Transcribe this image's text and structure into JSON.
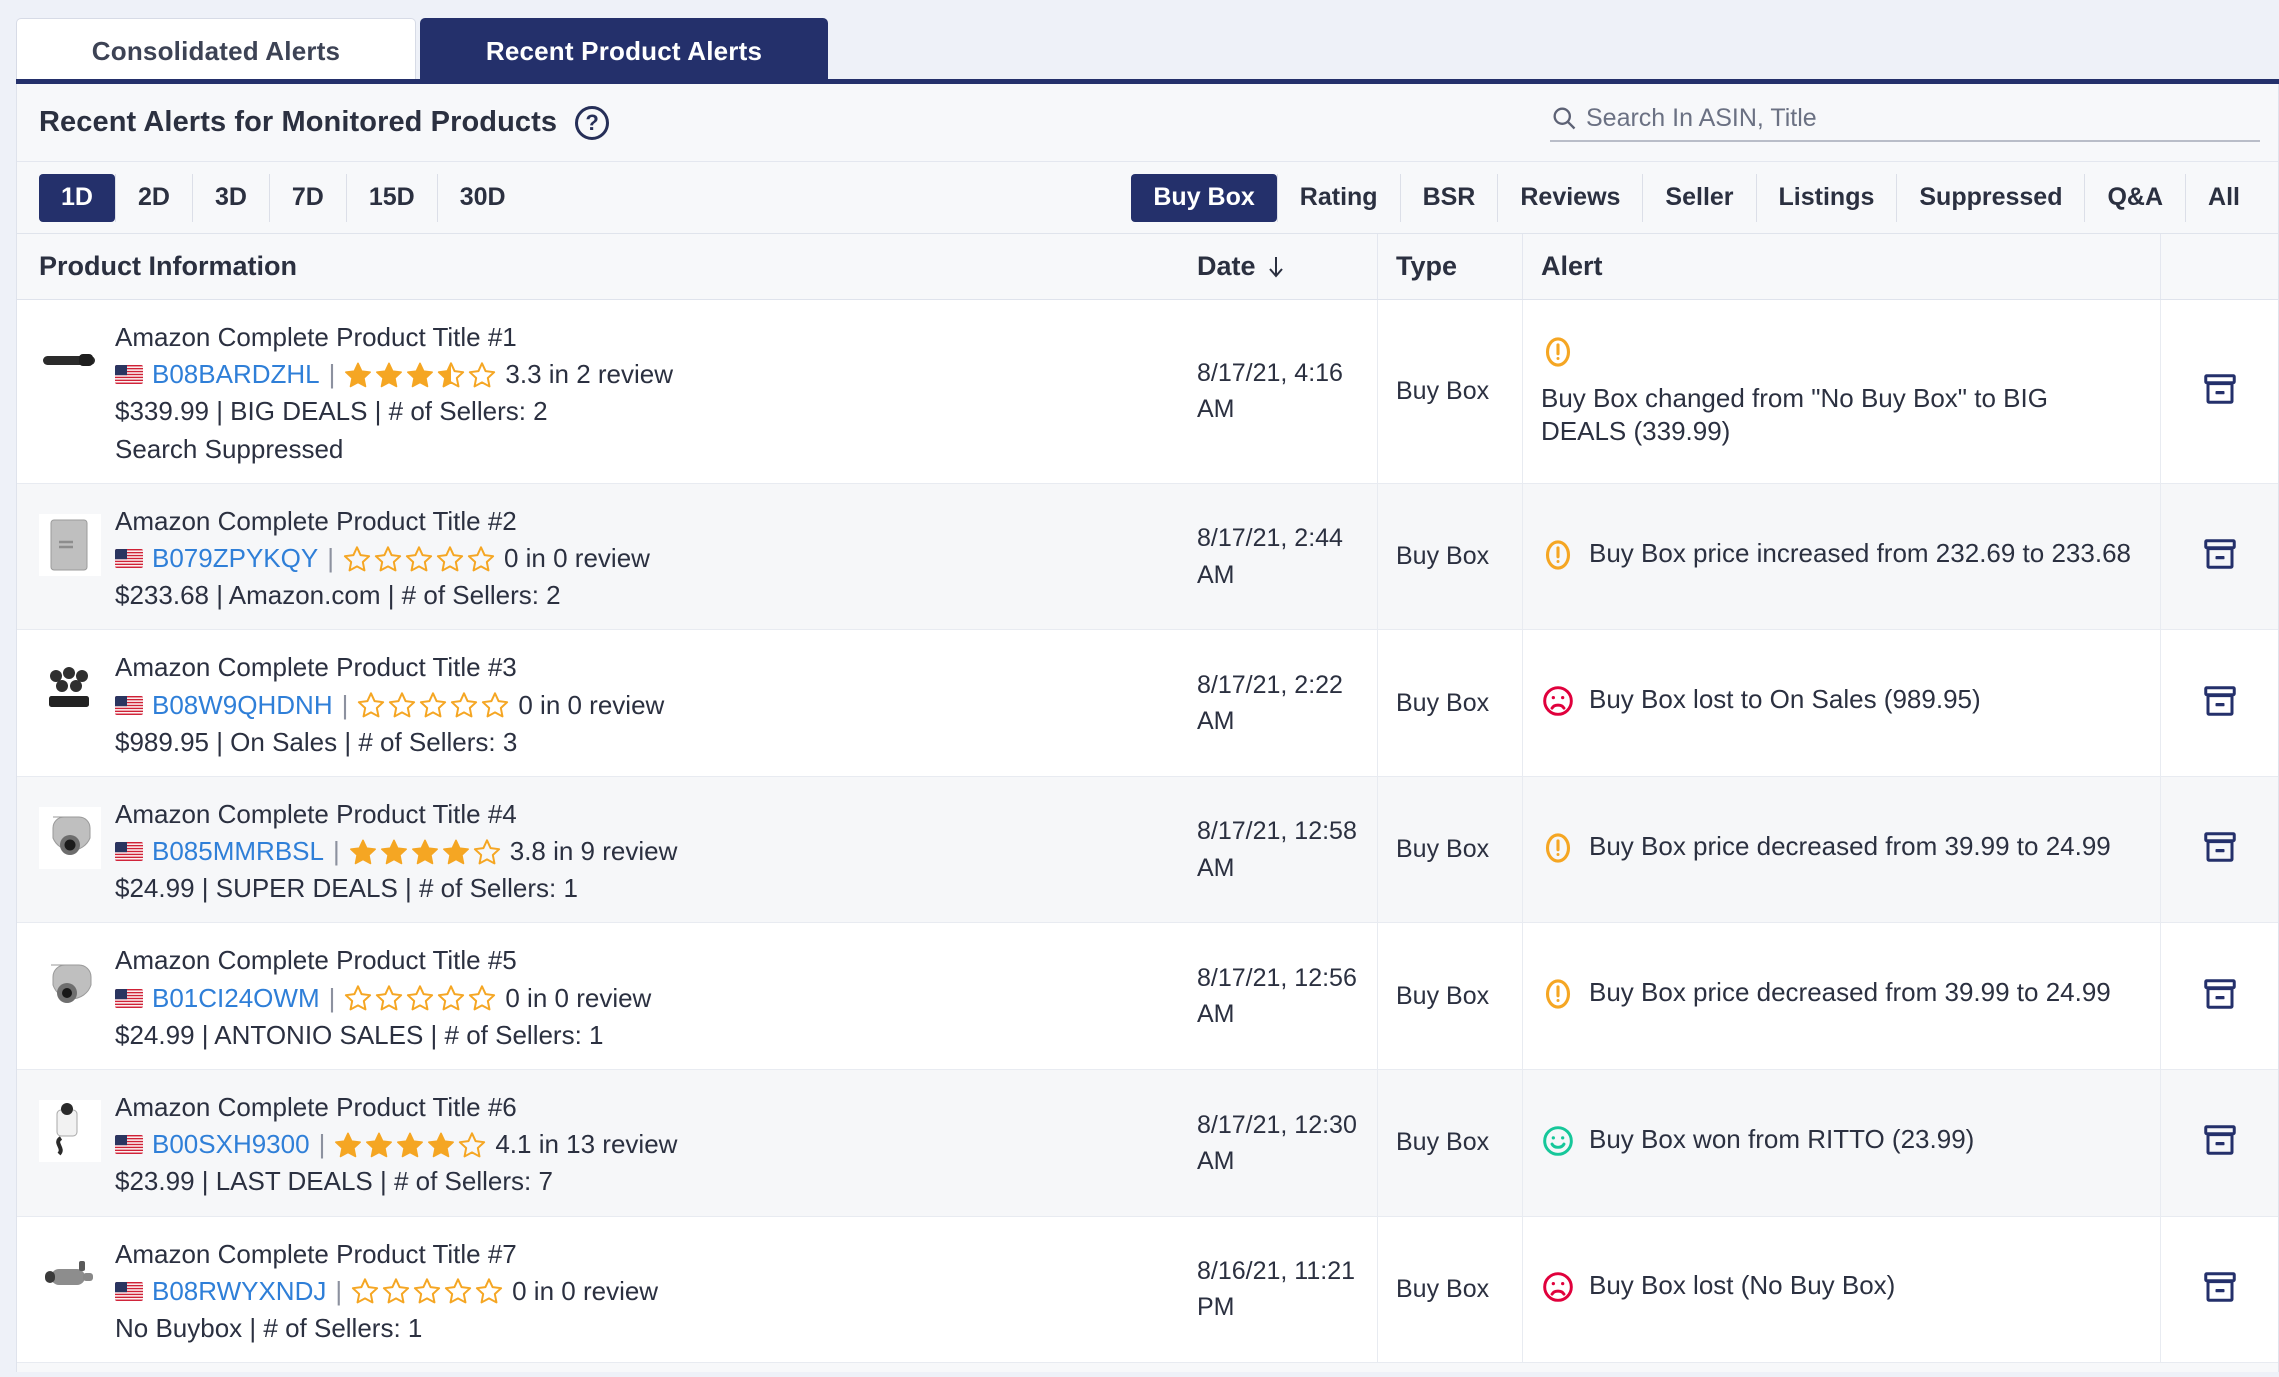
{
  "tabs": [
    {
      "label": "Consolidated Alerts",
      "active": false
    },
    {
      "label": "Recent Product Alerts",
      "active": true
    }
  ],
  "panel": {
    "title": "Recent Alerts for Monitored Products",
    "help_icon": "question-mark-circle-icon"
  },
  "search": {
    "placeholder": "Search In ASIN, Title",
    "value": "",
    "icon": "search-icon"
  },
  "filters": {
    "range": {
      "options": [
        "1D",
        "2D",
        "3D",
        "7D",
        "15D",
        "30D"
      ],
      "selected": "1D"
    },
    "type": {
      "options": [
        "Buy Box",
        "Rating",
        "BSR",
        "Reviews",
        "Seller",
        "Listings",
        "Suppressed",
        "Q&A",
        "All"
      ],
      "selected": "Buy Box"
    }
  },
  "table": {
    "columns": [
      "Product Information",
      "Date",
      "Type",
      "Alert"
    ],
    "sort_column": "Date",
    "sort_icon": "arrow-down-icon",
    "archive_icon": "archive-box-icon",
    "rows": [
      {
        "title": "Amazon Complete Product Title #1",
        "flag": "us-flag-icon",
        "asin": "B08BARDZHL",
        "stars": 3.5,
        "rating_text": "3.3 in 2 review",
        "price": "$339.99",
        "seller": "BIG DEALS",
        "sellers": "# of Sellers: 2",
        "extra": "Search Suppressed",
        "date": "8/17/21, 4:16 AM",
        "type": "Buy Box",
        "alert": "Buy Box changed from \"No Buy Box\" to BIG DEALS (339.99)",
        "alert_icon": "warning-exclamation-icon",
        "alert_color": "#f5a623",
        "alert_wrap": true
      },
      {
        "title": "Amazon Complete Product Title #2",
        "flag": "us-flag-icon",
        "asin": "B079ZPYKQY",
        "stars": 0,
        "rating_text": "0 in 0 review",
        "price": "$233.68",
        "seller": "Amazon.com",
        "sellers": "# of Sellers: 2",
        "extra": "",
        "date": "8/17/21, 2:44 AM",
        "type": "Buy Box",
        "alert": "Buy Box price increased from 232.69 to 233.68",
        "alert_icon": "warning-exclamation-icon",
        "alert_color": "#f5a623",
        "alert_wrap": false
      },
      {
        "title": "Amazon Complete Product Title #3",
        "flag": "us-flag-icon",
        "asin": "B08W9QHDNH",
        "stars": 0,
        "rating_text": "0 in 0 review",
        "price": "$989.95",
        "seller": "On Sales",
        "sellers": "# of Sellers: 3",
        "extra": "",
        "date": "8/17/21, 2:22 AM",
        "type": "Buy Box",
        "alert": "Buy Box lost to On Sales (989.95)",
        "alert_icon": "sad-face-icon",
        "alert_color": "#e0003c",
        "alert_wrap": false
      },
      {
        "title": "Amazon Complete Product Title #4",
        "flag": "us-flag-icon",
        "asin": "B085MMRBSL",
        "stars": 4,
        "rating_text": "3.8 in 9 review",
        "price": "$24.99",
        "seller": "SUPER DEALS",
        "sellers": "# of Sellers: 1",
        "extra": "",
        "date": "8/17/21, 12:58 AM",
        "type": "Buy Box",
        "alert": "Buy Box price decreased from 39.99 to 24.99",
        "alert_icon": "warning-exclamation-icon",
        "alert_color": "#f5a623",
        "alert_wrap": false
      },
      {
        "title": "Amazon Complete Product Title #5",
        "flag": "us-flag-icon",
        "asin": "B01CI24OWM",
        "stars": 0,
        "rating_text": "0 in 0 review",
        "price": "$24.99",
        "seller": "ANTONIO SALES",
        "sellers": "# of Sellers: 1",
        "extra": "",
        "date": "8/17/21, 12:56 AM",
        "type": "Buy Box",
        "alert": "Buy Box price decreased from 39.99 to 24.99",
        "alert_icon": "warning-exclamation-icon",
        "alert_color": "#f5a623",
        "alert_wrap": false
      },
      {
        "title": "Amazon Complete Product Title #6",
        "flag": "us-flag-icon",
        "asin": "B00SXH9300",
        "stars": 4,
        "rating_text": "4.1 in 13 review",
        "price": "$23.99",
        "seller": "LAST DEALS",
        "sellers": "# of Sellers: 7",
        "extra": "",
        "date": "8/17/21, 12:30 AM",
        "type": "Buy Box",
        "alert": "Buy Box won from RITTO (23.99)",
        "alert_icon": "happy-face-icon",
        "alert_color": "#16c79a",
        "alert_wrap": false
      },
      {
        "title": "Amazon Complete Product Title #7",
        "flag": "us-flag-icon",
        "asin": "B08RWYXNDJ",
        "stars": 0,
        "rating_text": "0 in 0 review",
        "price": "No Buybox",
        "seller": "",
        "sellers": "# of Sellers: 1",
        "extra": "",
        "date": "8/16/21, 11:21 PM",
        "type": "Buy Box",
        "alert": "Buy Box lost (No Buy Box)",
        "alert_icon": "sad-face-icon",
        "alert_color": "#e0003c",
        "alert_wrap": false
      }
    ]
  },
  "colors": {
    "brand_navy": "#24306b",
    "link_blue": "#2f7fd8",
    "star_gold": "#f5a623",
    "warn": "#f5a623",
    "bad": "#e0003c",
    "good": "#16c79a"
  }
}
